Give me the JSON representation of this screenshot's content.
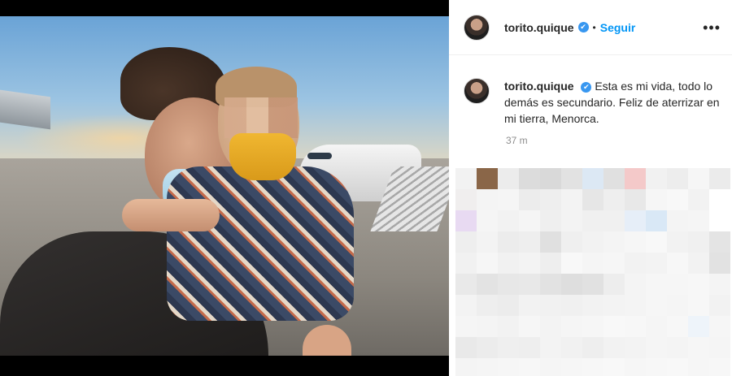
{
  "post": {
    "username": "torito.quique",
    "follow_label": "Seguir",
    "separator": "•",
    "more_label": "•••",
    "verified_icon": "✔",
    "caption": "Esta es mi vida, todo lo demás es secundario. Feliz de aterrizar en mi tierra, Menorca.",
    "time": "37 m"
  },
  "colors": {
    "accent": "#0095f6",
    "verified": "#3897f0",
    "text": "#262626",
    "muted": "#8e8e8e"
  },
  "pixel_colors": [
    [
      "#f2f2f2",
      "#8a6648",
      "#ececec",
      "#dcdcdc",
      "#d9d9d9",
      "#e2e2e2",
      "#dce8f4",
      "#e0e0e0",
      "#f4c9c9",
      "#f1f1f1",
      "#ededed",
      "#f6f6f6",
      "#ebebeb"
    ],
    [
      "#f0eeee",
      "#f4f4f4",
      "#f5f5f5",
      "#ececec",
      "#eeeeee",
      "#f3f3f3",
      "#e6e6e6",
      "#eeeeee",
      "#e8e8e8",
      "#f6f6f6",
      "#f8f8f8",
      "#f2f2f2",
      "#ffffff"
    ],
    [
      "#e8daf2",
      "#f5f5f5",
      "#f2f2f2",
      "#f5f5f5",
      "#efefef",
      "#f3f3f3",
      "#f0f0f0",
      "#f0f0f0",
      "#e6eef8",
      "#d9e8f6",
      "#f4f4f4",
      "#f5f5f5",
      "#ffffff"
    ],
    [
      "#eeeeee",
      "#f3f3f3",
      "#ececec",
      "#eeeeee",
      "#e0e0e0",
      "#efefef",
      "#f2f2f2",
      "#f4f4f4",
      "#f6f6f6",
      "#f8f8f8",
      "#f2f2f2",
      "#f0f0f0",
      "#e4e4e4"
    ],
    [
      "#f1f1f1",
      "#f6f6f6",
      "#f1f1f1",
      "#f3f3f3",
      "#eeeeee",
      "#f8f8f8",
      "#f5f5f5",
      "#f6f6f6",
      "#f2f2f2",
      "#f3f3f3",
      "#f7f7f7",
      "#f2f2f2",
      "#e2e2e2"
    ],
    [
      "#e9e9e9",
      "#e3e3e3",
      "#e7e7e7",
      "#e8e8e8",
      "#e2e2e2",
      "#dedede",
      "#e1e1e1",
      "#ededed",
      "#f4f4f4",
      "#f6f6f6",
      "#f6f6f6",
      "#f7f7f7",
      "#f4f4f4"
    ],
    [
      "#f3f3f3",
      "#eeeeee",
      "#ececec",
      "#f2f2f2",
      "#f1f1f1",
      "#f0f0f0",
      "#f2f2f2",
      "#f3f3f3",
      "#f4f4f4",
      "#f6f6f6",
      "#f5f5f5",
      "#f7f7f7",
      "#f2f2f2"
    ],
    [
      "#f5f5f5",
      "#f4f4f4",
      "#f2f2f2",
      "#f6f6f6",
      "#f3f3f3",
      "#f5f5f5",
      "#f6f6f6",
      "#f8f8f8",
      "#f7f7f7",
      "#f5f5f5",
      "#f7f7f7",
      "#eef4fa",
      "#f6f6f6"
    ],
    [
      "#e9e9e9",
      "#ececec",
      "#efefef",
      "#eeeeee",
      "#f3f3f3",
      "#f1f1f1",
      "#eeeeee",
      "#f2f2f2",
      "#f3f3f3",
      "#f5f5f5",
      "#f4f4f4",
      "#f6f6f6",
      "#f5f5f5"
    ],
    [
      "#f4f4f4",
      "#f5f5f5",
      "#f6f6f6",
      "#f7f7f7",
      "#f5f5f5",
      "#f6f6f6",
      "#f7f7f7",
      "#f8f8f8",
      "#f6f6f6",
      "#f7f7f7",
      "#f8f8f8",
      "#f6f6f6",
      "#f7f7f7"
    ]
  ]
}
